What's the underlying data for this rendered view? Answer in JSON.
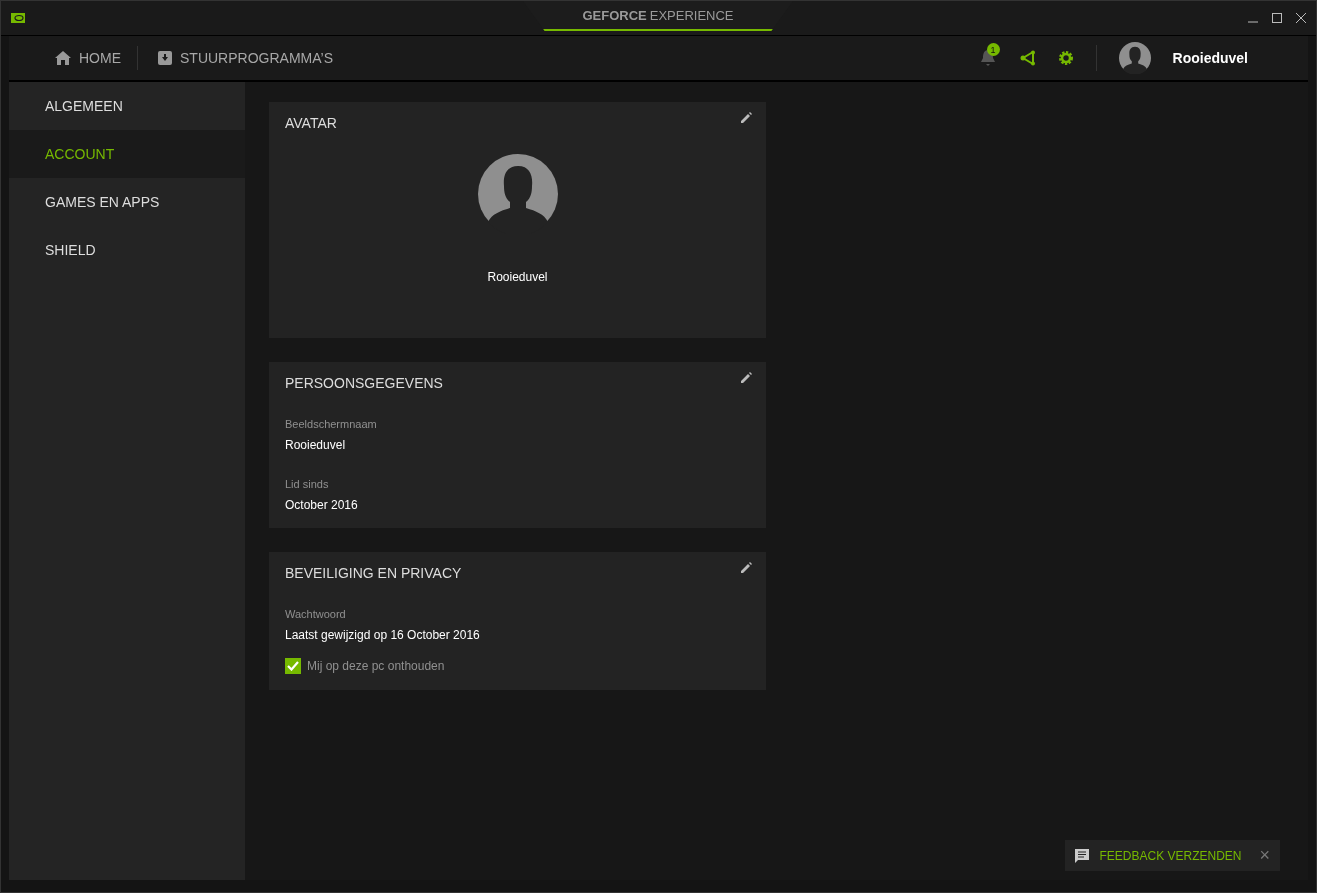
{
  "window": {
    "title_brand": "GEFORCE",
    "title_product": "EXPERIENCE"
  },
  "nav": {
    "tabs": [
      {
        "label": "HOME",
        "selected": false
      },
      {
        "label": "STUURPROGRAMMA’S",
        "selected": false
      }
    ],
    "notification_count": "1",
    "user_name": "Rooieduvel"
  },
  "sidebar": {
    "items": [
      {
        "label": "ALGEMEEN",
        "selected": false
      },
      {
        "label": "ACCOUNT",
        "selected": true
      },
      {
        "label": "GAMES EN APPS",
        "selected": false
      },
      {
        "label": "SHIELD",
        "selected": false
      }
    ]
  },
  "cards": [
    {
      "kind": "avatar",
      "title": "AVATAR",
      "name": "Rooieduvel"
    },
    {
      "kind": "fields",
      "title": "PERSOONSGEGEVENS",
      "fields": [
        {
          "label": "Beeldschermnaam",
          "value": "Rooieduvel"
        },
        {
          "label": "Lid sinds",
          "value": "October 2016"
        }
      ]
    },
    {
      "kind": "fields",
      "title": "BEVEILIGING EN PRIVACY",
      "fields": [
        {
          "label": "Wachtwoord",
          "value": "Laatst gewijzigd op 16 October 2016"
        }
      ],
      "checkbox": {
        "label": "Mij op deze pc onthouden",
        "checked": true
      }
    }
  ],
  "feedback": {
    "label": "FEEDBACK VERZENDEN",
    "close": "×"
  }
}
